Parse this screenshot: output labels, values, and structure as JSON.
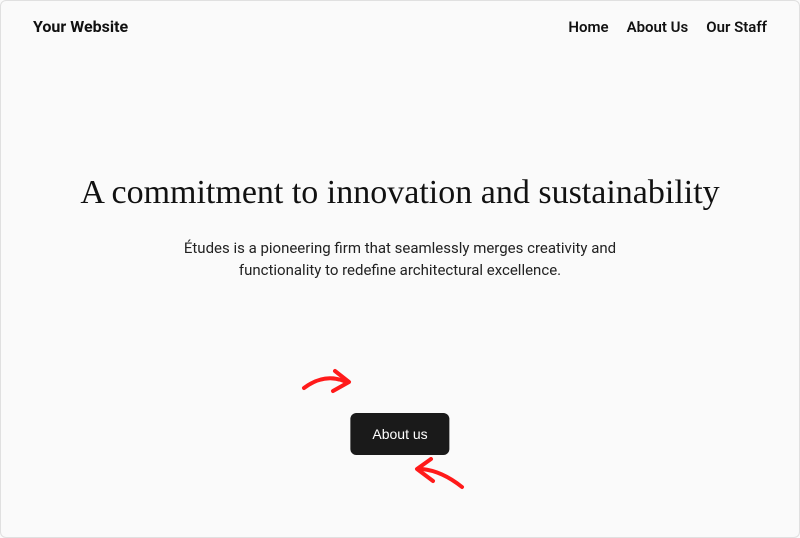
{
  "header": {
    "site_title": "Your Website",
    "nav": [
      {
        "label": "Home"
      },
      {
        "label": "About Us"
      },
      {
        "label": "Our Staff"
      }
    ]
  },
  "hero": {
    "title": "A commitment to innovation and sustainability",
    "subtitle": "Études is a pioneering firm that seamlessly merges creativity and functionality to redefine architectural excellence."
  },
  "cta": {
    "label": "About us"
  },
  "annotations": {
    "arrow_color": "#ff1a1a"
  }
}
